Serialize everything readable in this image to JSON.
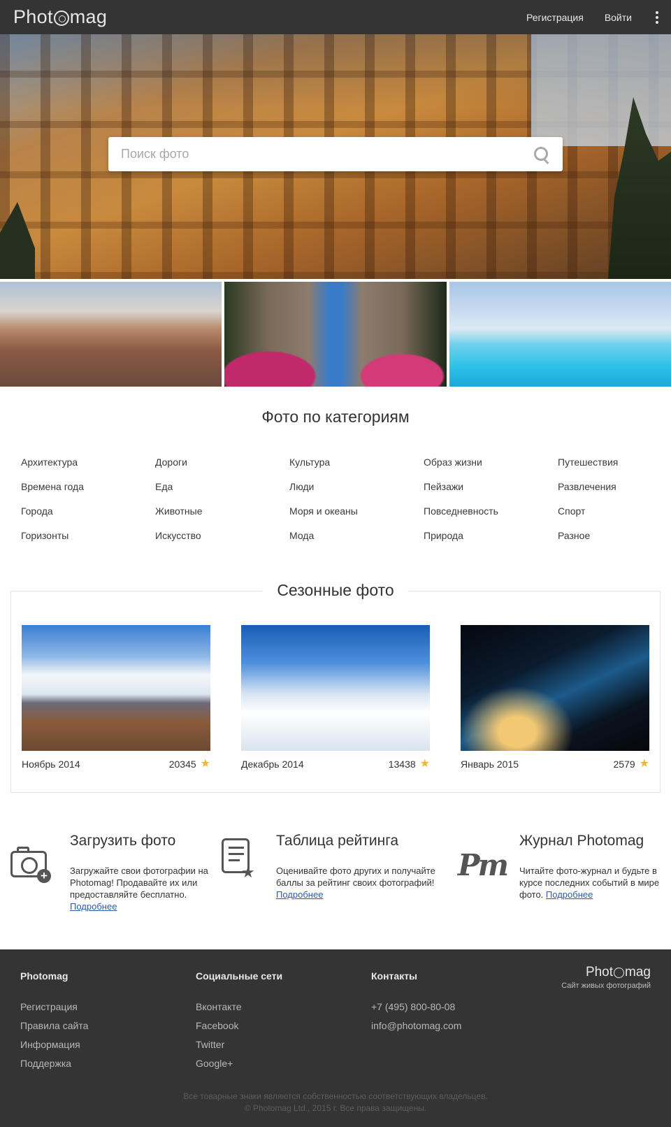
{
  "header": {
    "logo": {
      "before": "Phot",
      "after": "mag"
    },
    "nav": {
      "register": "Регистрация",
      "login": "Войти"
    }
  },
  "hero": {
    "search_placeholder": "Поиск фото"
  },
  "categories": {
    "title": "Фото по категориям",
    "items": [
      "Архитектура",
      "Дороги",
      "Культура",
      "Образ жизни",
      "Путешествия",
      "Времена года",
      "Еда",
      "Люди",
      "Пейзажи",
      "Развлечения",
      "Города",
      "Животные",
      "Моря и океаны",
      "Повседневность",
      "Спорт",
      "Горизонты",
      "Искусство",
      "Мода",
      "Природа",
      "Разное"
    ]
  },
  "seasonal": {
    "title": "Сезонные фото",
    "cards": [
      {
        "label": "Ноябрь 2014",
        "count": "20345"
      },
      {
        "label": "Декабрь 2014",
        "count": "13438"
      },
      {
        "label": "Январь 2015",
        "count": "2579"
      }
    ]
  },
  "features": [
    {
      "title": "Загрузить фото",
      "text": "Загружайте свои фотографии на Photomag! Продавайте их или предоставляйте бесплатно.",
      "more": "Подробнее",
      "icon": "camera-plus-icon"
    },
    {
      "title": "Таблица рейтинга",
      "text": "Оценивайте фото других и получайте баллы за рейтинг своих фотографий!",
      "more": "Подробнее",
      "icon": "list-star-icon"
    },
    {
      "title": "Журнал Photomag",
      "text": "Читайте фото-журнал и будьте в курсе последних событий в мире фото.",
      "more": "Подробнее",
      "icon": "pm-monogram-icon",
      "monogram": "Pm"
    }
  ],
  "footer": {
    "col1": {
      "title": "Photomag",
      "links": [
        "Регистрация",
        "Правила сайта",
        "Информация",
        "Поддержка"
      ]
    },
    "col2": {
      "title": "Социальные сети",
      "links": [
        "Вконтакте",
        "Facebook",
        "Twitter",
        "Google+"
      ]
    },
    "col3": {
      "title": "Контакты",
      "links": [
        "+7 (495) 800-80-08",
        "info@photomag.com"
      ]
    },
    "logo": {
      "before": "Phot",
      "after": "mag",
      "tagline": "Сайт живых фотографий"
    },
    "copyright1": "Все товарные знаки являются собственностью соответствующих владельцев.",
    "copyright2": "© Photomag Ltd., 2015 г. Все права защищены."
  },
  "colors": {
    "header_bg": "#343434",
    "link": "#2a5ca8",
    "star": "#f2b632"
  }
}
